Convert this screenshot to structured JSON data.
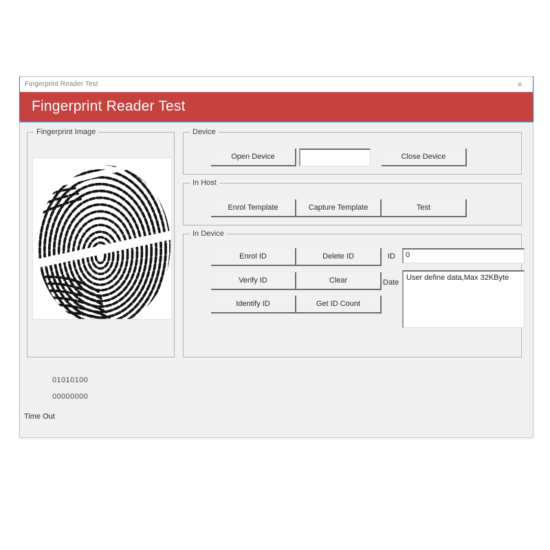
{
  "window": {
    "titlebar_text": "Fingerprint Reader Test",
    "close_icon": "×",
    "header_title": "Fingerprint Reader Test",
    "header_color": "#c5423f",
    "accent_color": "#2e86d6"
  },
  "fingerprint_panel": {
    "label": "Fingerprint Image"
  },
  "device_group": {
    "label": "Device",
    "open_button": "Open Device",
    "close_button": "Close Device",
    "device_input_value": "",
    "device_input_placeholder": ""
  },
  "in_host_group": {
    "label": "In Host",
    "enrol_template_button": "Enrol Template",
    "capture_template_button": "Capture Template",
    "test_button": "Test"
  },
  "in_device_group": {
    "label": "In Device",
    "enrol_id_button": "Enrol ID",
    "delete_id_button": "Delete ID",
    "verify_id_button": "Verify ID",
    "clear_button": "Clear",
    "identify_id_button": "Identify ID",
    "get_id_count_button": "Get ID Count",
    "id_label": "ID",
    "id_value": "0",
    "date_label": "Date",
    "date_value": "User define data,Max 32KByte"
  },
  "output": {
    "line1": "01010100",
    "line2": "00000000",
    "status": "Time Out"
  }
}
